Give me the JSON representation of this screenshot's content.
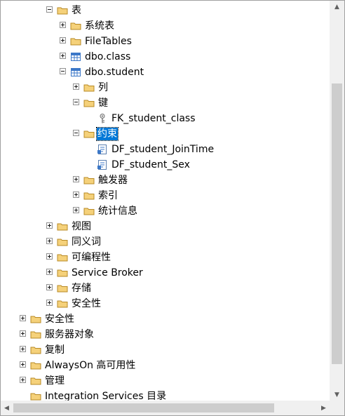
{
  "tree": {
    "tables": "表",
    "system_tables": "系统表",
    "file_tables": "FileTables",
    "dbo_class": "dbo.class",
    "dbo_student": "dbo.student",
    "columns": "列",
    "keys": "键",
    "fk_student_class": "FK_student_class",
    "constraints": "约束",
    "df_student_jointime": "DF_student_JoinTime",
    "df_student_sex": "DF_student_Sex",
    "triggers": "触发器",
    "indexes": "索引",
    "statistics": "统计信息",
    "views": "视图",
    "synonyms": "同义词",
    "programmability": "可编程性",
    "service_broker": "Service Broker",
    "storage": "存储",
    "security_db": "安全性",
    "security": "安全性",
    "server_objects": "服务器对象",
    "replication": "复制",
    "alwayson": "AlwaysOn 高可用性",
    "management": "管理",
    "integration_services": "Integration Services 目录"
  },
  "scrollbar": {
    "up_arrow": "▲",
    "down_arrow": "▼",
    "left_arrow": "◀",
    "right_arrow": "▶"
  },
  "colors": {
    "selection": "#0078d7",
    "folder": "#e8b64c",
    "table": "#3c78c8"
  }
}
